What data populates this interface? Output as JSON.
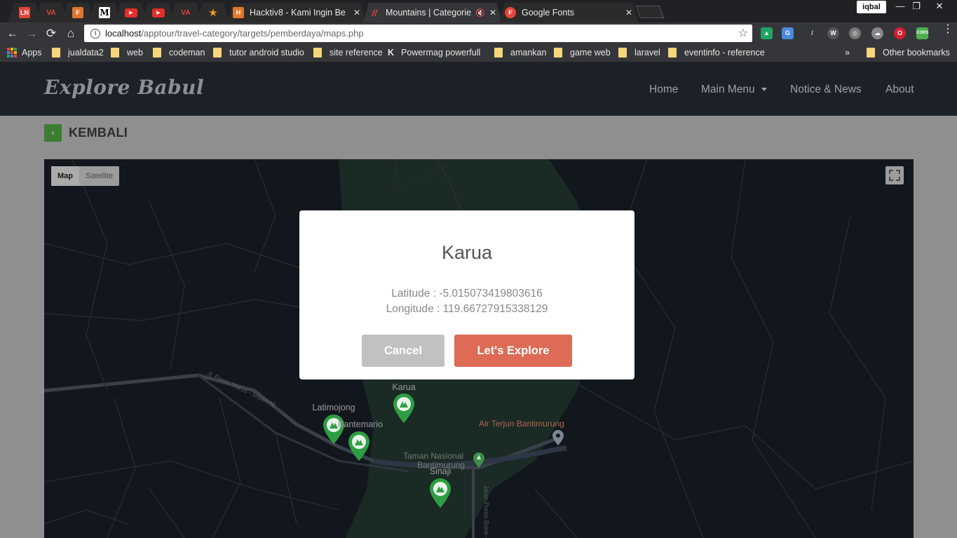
{
  "browser": {
    "profile_name": "iqbal",
    "pinned_tabs": [
      {
        "icon": "ln-icon",
        "text": "LN",
        "color": "#e0453a"
      },
      {
        "icon": "laracasts-icon",
        "text": "VA",
        "color": "#e0453a"
      },
      {
        "icon": "fox-icon",
        "text": "F",
        "color": "#e2762b"
      },
      {
        "icon": "medium-icon",
        "text": "M",
        "color": "#000000"
      },
      {
        "icon": "youtube-icon",
        "text": "▶",
        "color": "#e52d27"
      },
      {
        "icon": "youtube-icon",
        "text": "▶",
        "color": "#e52d27"
      },
      {
        "icon": "laracasts-icon",
        "text": "VA",
        "color": "#e0453a"
      },
      {
        "icon": "star-icon",
        "text": "★",
        "color": "#f39a1c"
      }
    ],
    "tabs": [
      {
        "title": "Hacktiv8 - Kami Ingin Be",
        "icon_color": "#e2762b",
        "icon_text": "H"
      },
      {
        "title": "Mountains | Categorie",
        "icon_color": "#e0453a",
        "icon_text": "//",
        "active": true
      },
      {
        "title": "Google Fonts",
        "icon_color": "#e8453c",
        "icon_text": "F"
      }
    ],
    "address": {
      "host": "localhost",
      "path": "/apptour/travel-category/targets/pemberdaya/maps.php"
    },
    "window_controls": [
      "—",
      "❐",
      "✕"
    ],
    "bookmarks": [
      {
        "label": "Apps",
        "type": "apps"
      },
      {
        "label": "jualdata2",
        "type": "folder"
      },
      {
        "label": "web",
        "type": "folder"
      },
      {
        "label": "codeman",
        "type": "folder"
      },
      {
        "label": "tutor android studio",
        "type": "folder"
      },
      {
        "label": "site reference",
        "type": "folder"
      },
      {
        "label": "Powermag powerfull",
        "type": "site"
      },
      {
        "label": "amankan",
        "type": "folder"
      },
      {
        "label": "game web",
        "type": "folder"
      },
      {
        "label": "laravel",
        "type": "folder"
      },
      {
        "label": "eventinfo - reference",
        "type": "folder"
      }
    ],
    "bookmarks_overflow": "»",
    "other_bookmarks": "Other bookmarks"
  },
  "site": {
    "brand": "Explore Babul",
    "nav": [
      {
        "label": "Home"
      },
      {
        "label": "Main Menu"
      },
      {
        "label": "Notice & News"
      },
      {
        "label": "About"
      }
    ],
    "back_icon": "‹",
    "back_label": "KEMBALI"
  },
  "map": {
    "type_options": [
      "Map",
      "Satellite"
    ],
    "selected_type": "Map",
    "markers": [
      {
        "label": "Karua"
      },
      {
        "label": "Latimojong"
      },
      {
        "label": "Bantemario"
      },
      {
        "label": "Sinaji"
      }
    ],
    "poi": [
      {
        "label": "Air Terjun Bantimurung",
        "color": "#b06850"
      },
      {
        "label": "Taman Nasional",
        "color": "#6e7a70"
      },
      {
        "label": "Bantimurung",
        "color": "#6e7a70"
      }
    ],
    "roads": [
      {
        "label": "Jl. Poros Maros - Soppeng"
      },
      {
        "label": "Jalan Poros Bone -"
      }
    ]
  },
  "modal": {
    "title": "Karua",
    "latitude_text": "Latitude : -5.015073419803616",
    "longitude_text": "Longitude : 119.66727915338129",
    "cancel_label": "Cancel",
    "confirm_label": "Let's Explore",
    "confirm_color": "#dd6b55",
    "cancel_color": "#c1c1c1"
  }
}
